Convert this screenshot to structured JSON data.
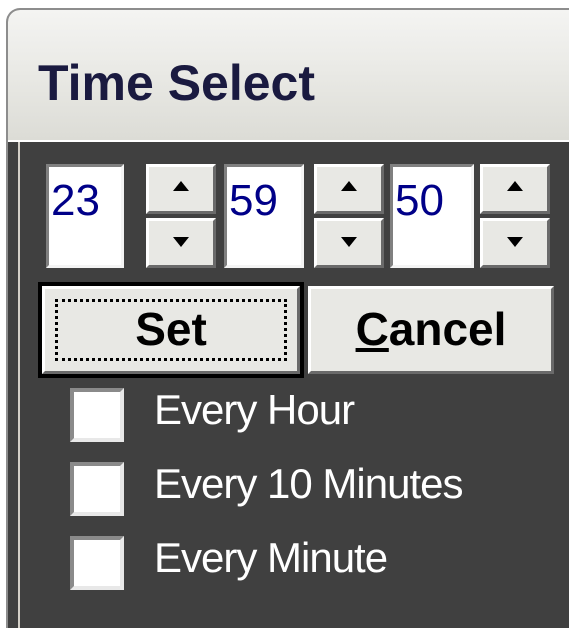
{
  "window": {
    "title": "Time Select"
  },
  "time": {
    "hour": "23",
    "minute": "59",
    "second": "50"
  },
  "buttons": {
    "set_label": "Set",
    "cancel_prefix": "C",
    "cancel_rest": "ancel"
  },
  "options": [
    {
      "label": "Every Hour",
      "checked": false
    },
    {
      "label": "Every 10 Minutes",
      "checked": false
    },
    {
      "label": "Every Minute",
      "checked": false
    }
  ],
  "colors": {
    "client_bg": "#404040",
    "number_text": "#000088",
    "option_text": "#ffffff",
    "title_text": "#1a1a40"
  },
  "icons": {
    "spin_up": "triangle-up-icon",
    "spin_down": "triangle-down-icon"
  }
}
